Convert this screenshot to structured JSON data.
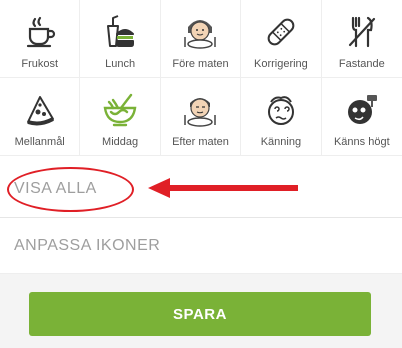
{
  "tiles": [
    {
      "label": "Frukost",
      "icon": "coffee-cup-icon"
    },
    {
      "label": "Lunch",
      "icon": "burger-drink-icon"
    },
    {
      "label": "Före maten",
      "icon": "girl-with-plate-icon"
    },
    {
      "label": "Korrigering",
      "icon": "bandage-icon"
    },
    {
      "label": "Fastande",
      "icon": "no-cutlery-icon"
    },
    {
      "label": "Mellanmål",
      "icon": "pizza-slice-icon"
    },
    {
      "label": "Middag",
      "icon": "salad-bowl-icon"
    },
    {
      "label": "Efter maten",
      "icon": "full-boy-icon"
    },
    {
      "label": "Känning",
      "icon": "dizzy-face-icon"
    },
    {
      "label": "Känns högt",
      "icon": "high-sugar-face-icon"
    }
  ],
  "show_all_label": "VISA ALLA",
  "customize_label": "ANPASSA IKONER",
  "save_label": "SPARA",
  "colors": {
    "accent_green": "#7ab237",
    "annotation_red": "#e01f26",
    "label_grey": "#9e9e9e"
  }
}
